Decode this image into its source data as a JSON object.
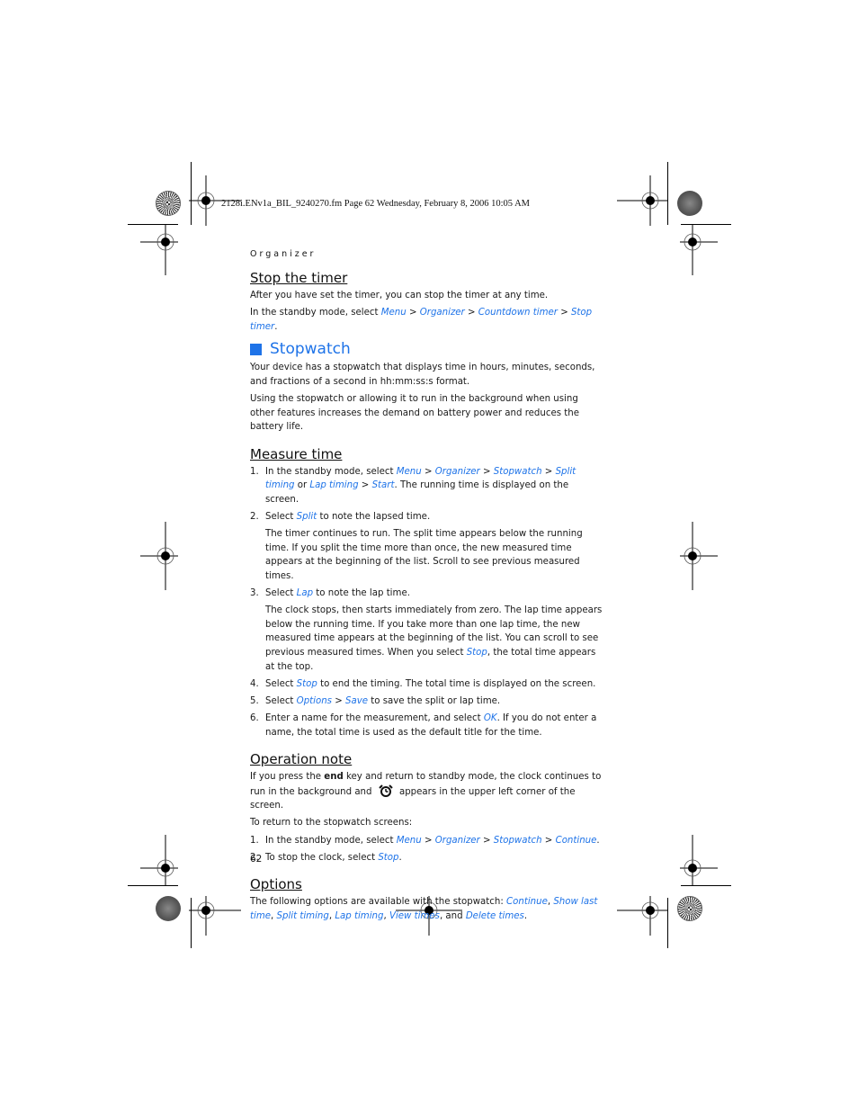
{
  "print_header": {
    "file_info": "2128i.ENv1a_BIL_9240270.fm  Page 62  Wednesday, February 8, 2006  10:05 AM"
  },
  "section_kicker": "Organizer",
  "stop_timer": {
    "heading": "Stop the timer",
    "p1": "After you have set the timer, you can stop the timer at any time.",
    "p2_prefix": "In the standby mode, select ",
    "path": [
      "Menu",
      "Organizer",
      "Countdown timer",
      "Stop timer"
    ],
    "separator": " > ",
    "p2_suffix": "."
  },
  "stopwatch": {
    "heading": "Stopwatch",
    "accent_color": "#1e73e8",
    "p1": "Your device has a stopwatch that displays time in hours, minutes, seconds, and fractions of a second in hh:mm:ss:s format.",
    "p2": "Using the stopwatch or allowing it to run in the background when using other features increases the demand on battery power and reduces the battery life."
  },
  "measure_time": {
    "heading": "Measure time",
    "steps": [
      {
        "num": "1.",
        "prefix": "In the standby mode, select ",
        "l1": "Menu",
        "l2": "Organizer",
        "l3": "Stopwatch",
        "l4": "Split timing",
        "or": " or ",
        "l5": "Lap timing",
        "l6": "Start",
        "suffix": ". The running time is displayed on the screen."
      },
      {
        "num": "2.",
        "prefix": "Select ",
        "l1": "Split",
        "suffix": " to note the lapsed time.",
        "detail": "The timer continues to run. The split time appears below the running time. If you split the time more than once, the new measured time appears at the beginning of the list. Scroll to see previous measured times."
      },
      {
        "num": "3.",
        "prefix": "Select ",
        "l1": "Lap",
        "suffix": " to note the lap time.",
        "detail_prefix": "The clock stops, then starts immediately from zero. The lap time appears below the running time. If you take more than one lap time, the new measured time appears at the beginning of the list. You can scroll to see previous measured times. When you select ",
        "detail_link": "Stop",
        "detail_suffix": ", the total time appears at the top."
      },
      {
        "num": "4.",
        "prefix": "Select ",
        "l1": "Stop",
        "suffix": " to end the timing. The total time is displayed on the screen."
      },
      {
        "num": "5.",
        "prefix": "Select ",
        "l1": "Options",
        "l2": "Save",
        "suffix": " to save the split or lap time."
      },
      {
        "num": "6.",
        "prefix": "Enter a name for the measurement, and select ",
        "l1": "OK",
        "suffix": ". If you do not enter a name, the total time is used as the default title for the time."
      }
    ]
  },
  "operation_note": {
    "heading": "Operation note",
    "p1_a": "If you press the ",
    "p1_bold": "end",
    "p1_b": " key and return to standby mode, the clock continues to run in the background and ",
    "icon": "stopwatch-running-icon",
    "p1_c": " appears in the upper left corner of the screen.",
    "p2": "To return to the stopwatch screens:",
    "steps": [
      {
        "num": "1.",
        "prefix": "In the standby mode, select ",
        "l1": "Menu",
        "l2": "Organizer",
        "l3": "Stopwatch",
        "l4": "Continue",
        "suffix": "."
      },
      {
        "num": "2.",
        "prefix": "To stop the clock, select ",
        "l1": "Stop",
        "suffix": "."
      }
    ]
  },
  "options": {
    "heading": "Options",
    "prefix": "The following options are available with the stopwatch: ",
    "items": [
      "Continue",
      "Show last time",
      "Split timing",
      "Lap timing",
      "View times",
      "Delete times"
    ],
    "and": ", and ",
    "comma": ", ",
    "suffix": "."
  },
  "page_number": "62",
  "gt": " > "
}
